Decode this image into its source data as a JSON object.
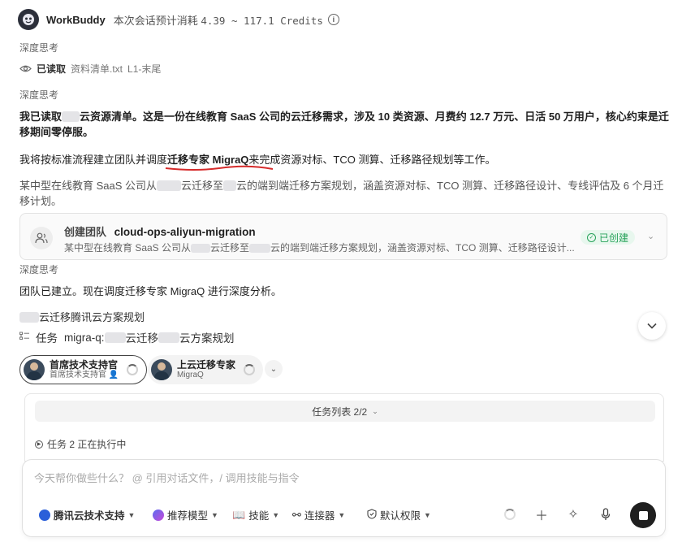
{
  "header": {
    "brand": "WorkBuddy",
    "cost_prefix": "本次会话预计消耗",
    "cost_value": "4.39 ~ 117.1 Credits"
  },
  "thinking_label": "深度思考",
  "read": {
    "status": "已读取",
    "file": "资料清单.txt",
    "range": "L1-末尾"
  },
  "paragraphs": {
    "p1_a": "我已读取",
    "p1_b": "云资源清单。这是一份在线教育 SaaS 公司的云迁移需求，涉及 10 类资源、月费约 12.7 万元、日活 50 万用户，核心约束是迁",
    "p1_c": "移期间零停服。",
    "p2_a": "我将按标准流程建立团队并调度",
    "p2_b": "迁移专家 MigraQ",
    "p2_c": "来完成资源对标、TCO 测算、迁移路径规划等工作。",
    "p3_a": "某中型在线教育 SaaS 公司从",
    "p3_b": "云迁移至",
    "p3_c": "云的端到端迁移方案规划，涵盖资源对标、TCO 测算、迁移路径设计、专线评估及 6 个月迁",
    "p3_d": "移计划。",
    "p4": "团队已建立。现在调度迁移专家 MigraQ 进行深度分析。",
    "p5": "云迁移腾讯云方案规划"
  },
  "team_card": {
    "label": "创建团队",
    "name": "cloud-ops-aliyun-migration",
    "desc_a": "某中型在线教育 SaaS 公司从",
    "desc_b": "云迁移至",
    "desc_c": "云的端到端迁移方案规划，涵盖资源对标、TCO 测算、迁移路径设计...",
    "status": "已创建"
  },
  "task": {
    "label": "任务",
    "name_a": "migra-q:",
    "name_b": "云迁移",
    "name_c": "云方案规划"
  },
  "agents": [
    {
      "name": "首席技术支持官",
      "role": "首席技术支持官"
    },
    {
      "name": "上云迁移专家",
      "role": "MigraQ"
    }
  ],
  "task_panel": {
    "list_label": "任务列表 2/2",
    "status": "任务 2 正在执行中"
  },
  "input": {
    "placeholder": "今天帮你做些什么？ @ 引用对话文件，/ 调用技能与指令",
    "tools": {
      "agent": "腾讯云技术支持",
      "model": "推荐模型",
      "skills": "技能",
      "connector": "连接器",
      "permission": "默认权限"
    }
  }
}
